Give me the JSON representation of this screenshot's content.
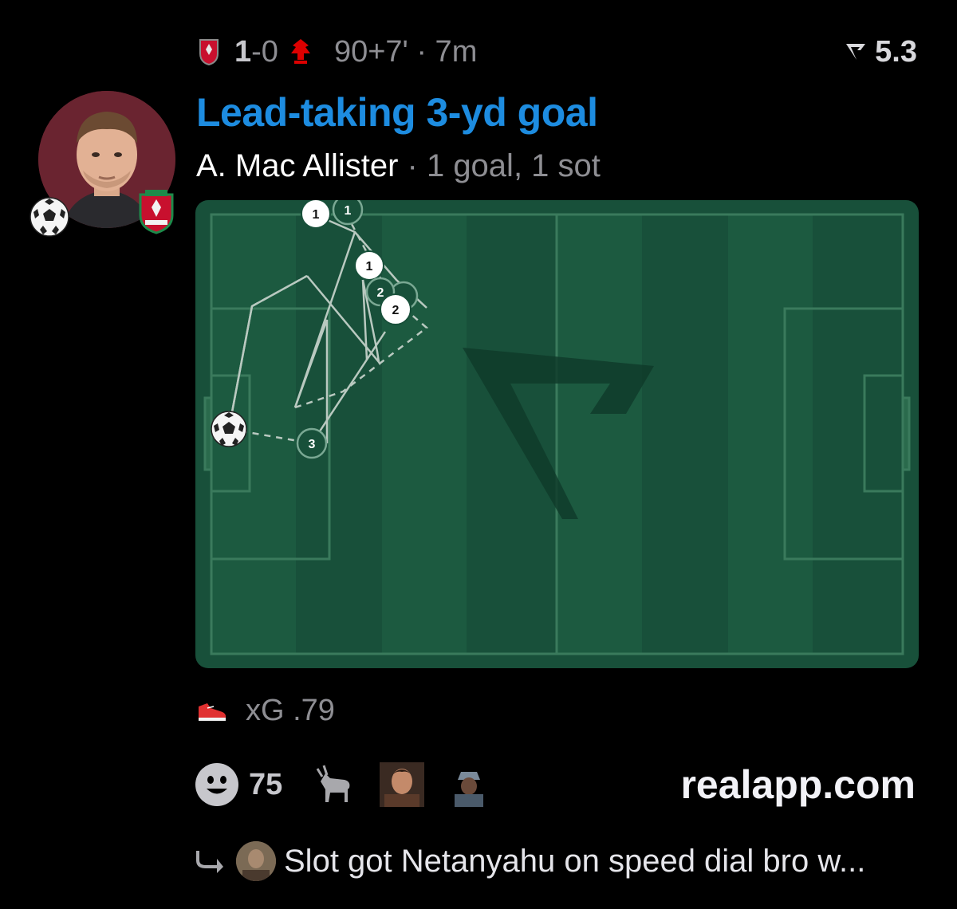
{
  "header": {
    "home_score": "1",
    "score_separator": "-",
    "away_score": "0",
    "minute": "90+7' · 7m",
    "rating": "5.3",
    "rating_icon": "realapp-logo-icon",
    "home_crest_icon": "liverpool-crest-icon",
    "away_crest_icon": "nottingham-forest-crest-icon"
  },
  "post": {
    "headline": "Lead-taking 3-yd goal",
    "player": "A. Mac Allister",
    "stats": " · 1 goal, 1 sot",
    "xg_label": "xG .79",
    "xg_icon": "boot-icon",
    "accent_color": "#1d8ce0"
  },
  "pitch": {
    "markers": [
      {
        "label": "1",
        "style": "white"
      },
      {
        "label": "1",
        "style": "green"
      },
      {
        "label": "1",
        "style": "white"
      },
      {
        "label": "2",
        "style": "green"
      },
      {
        "label": "2",
        "style": "white"
      },
      {
        "label": "3",
        "style": "green"
      }
    ],
    "pitch_color": "#18503a",
    "stripe_color": "#1c5a40"
  },
  "reactions": {
    "icon": "smiley-icon",
    "count": "75",
    "emoji": [
      "goat-icon",
      "reaction-gif-1",
      "reaction-gif-2"
    ]
  },
  "site": "realapp.com",
  "reply": {
    "icon": "reply-arrow-icon",
    "text": "Slot got Netanyahu on speed dial bro w..."
  }
}
